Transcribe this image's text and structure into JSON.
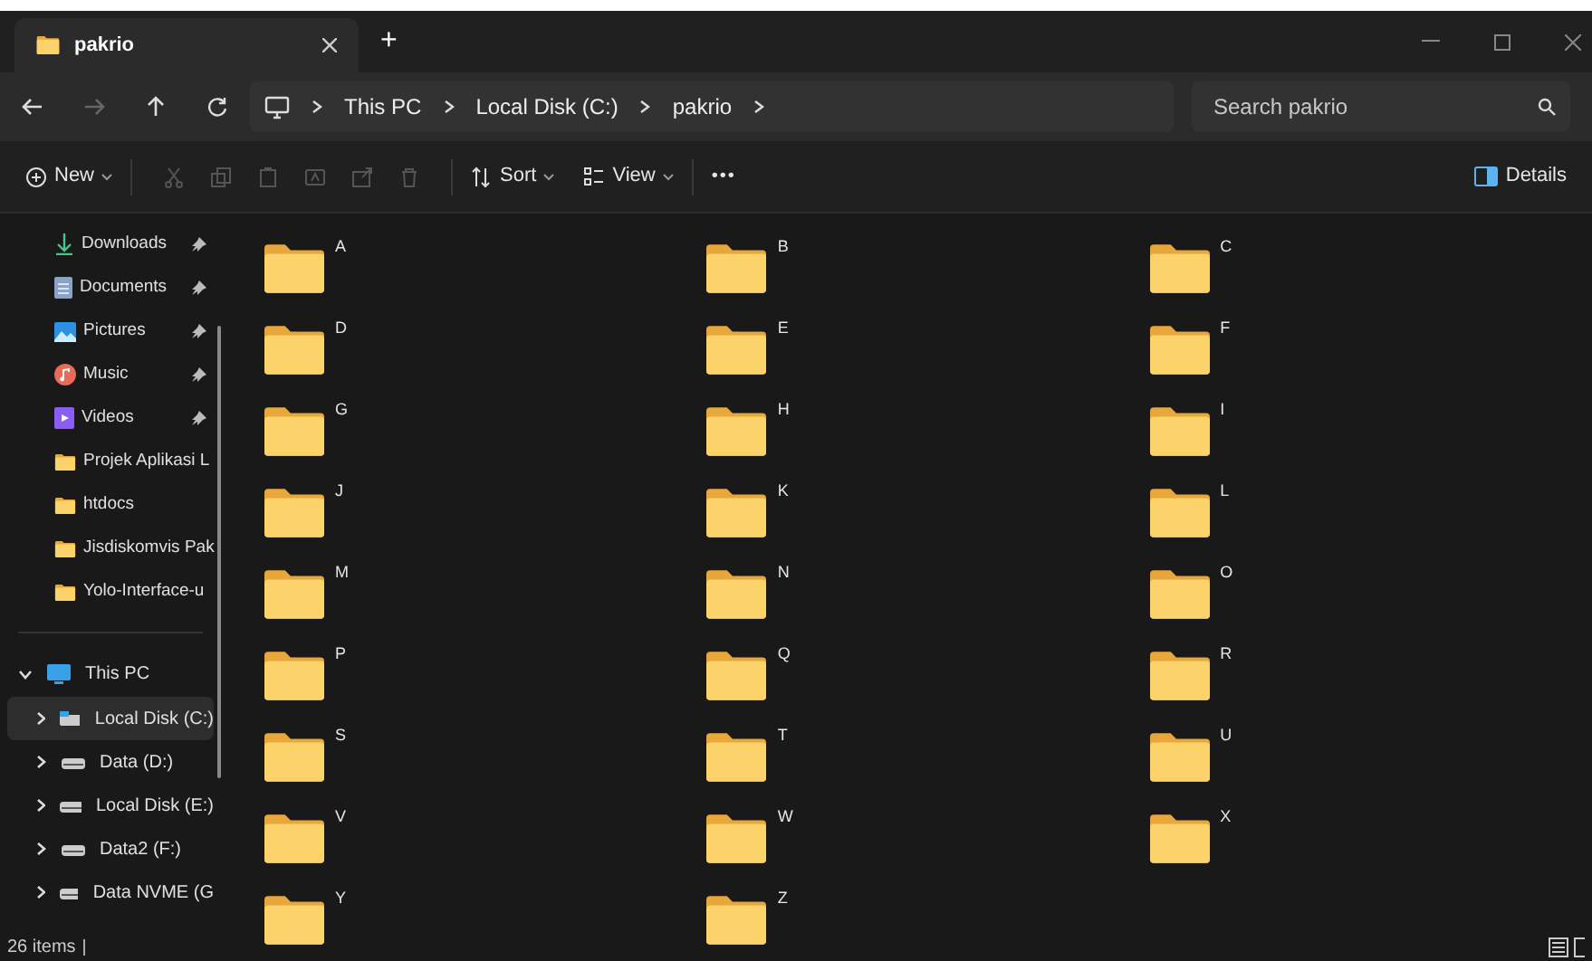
{
  "tabs": [
    {
      "label": "pakrio",
      "selected": true
    }
  ],
  "new_tab_label": "+",
  "breadcrumb": [
    "This PC",
    "Local Disk (C:)",
    "pakrio"
  ],
  "search": {
    "placeholder": "Search pakrio"
  },
  "toolbar": {
    "new_label": "New",
    "sort_label": "Sort",
    "view_label": "View",
    "more_label": "•••",
    "details_label": "Details"
  },
  "sidebar": {
    "items": [
      {
        "label": "Downloads",
        "kind": "downloads",
        "pinned": true
      },
      {
        "label": "Documents",
        "kind": "documents",
        "pinned": true
      },
      {
        "label": "Pictures",
        "kind": "pictures",
        "pinned": true
      },
      {
        "label": "Music",
        "kind": "music",
        "pinned": true
      },
      {
        "label": "Videos",
        "kind": "videos",
        "pinned": true
      },
      {
        "label": "Projek Aplikasi L",
        "kind": "folder",
        "pinned": false
      },
      {
        "label": "htdocs",
        "kind": "folder",
        "pinned": false
      },
      {
        "label": "Jisdiskomvis Pak",
        "kind": "folder",
        "pinned": false
      },
      {
        "label": "Yolo-Interface-u",
        "kind": "folder",
        "pinned": false
      }
    ],
    "this_pc": {
      "label": "This PC",
      "expanded": true,
      "children": [
        {
          "label": "Local Disk (C:)",
          "kind": "system",
          "selected": true
        },
        {
          "label": "Data (D:)",
          "kind": "drive",
          "selected": false
        },
        {
          "label": "Local Disk (E:)",
          "kind": "drive",
          "selected": false
        },
        {
          "label": "Data2 (F:)",
          "kind": "drive",
          "selected": false
        },
        {
          "label": "Data NVME (G",
          "kind": "drive",
          "selected": false
        }
      ]
    }
  },
  "folders": [
    "A",
    "B",
    "C",
    "D",
    "E",
    "F",
    "G",
    "H",
    "I",
    "J",
    "K",
    "L",
    "M",
    "N",
    "O",
    "P",
    "Q",
    "R",
    "S",
    "T",
    "U",
    "V",
    "W",
    "X",
    "Y",
    "Z"
  ],
  "status_bar": {
    "item_count": "26 items"
  }
}
